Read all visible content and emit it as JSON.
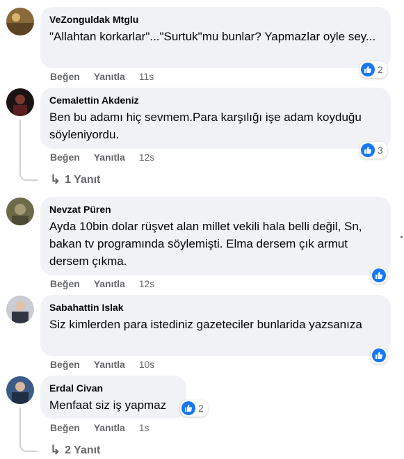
{
  "comments": [
    {
      "name": "VeZonguldak Mtglu",
      "text": "\"Allahtan korkarlar\"...\"Surtuk\"mu bunlar? Yapmazlar oyle sey...",
      "like": "Beğen",
      "reply": "Yanıtla",
      "time": "11s",
      "reactions": "2"
    },
    {
      "name": "Cemalettin Akdeniz",
      "text": "Ben bu adamı hiç sevmem.Para karşılığı işe adam koyduğu söyleniyordu.",
      "like": "Beğen",
      "reply": "Yanıtla",
      "time": "12s",
      "reactions": "3",
      "replies_link": "1 Yanıt"
    },
    {
      "name": "Nevzat Püren",
      "text": "Ayda 10bin dolar rüşvet alan millet vekili hala belli değil, Sn, bakan tv programında söylemişti. Elma dersem çık armut dersem çıkma.",
      "like": "Beğen",
      "reply": "Yanıtla",
      "time": "12s"
    },
    {
      "name": "Sabahattin Islak",
      "text": "Siz kimlerden para istediniz gazeteciler bunlarida yazsanıza",
      "like": "Beğen",
      "reply": "Yanıtla",
      "time": "10s"
    },
    {
      "name": "Erdal Civan",
      "text": "Menfaat siz iş yapmaz",
      "like": "Beğen",
      "reply": "Yanıtla",
      "time": "1s",
      "reactions": "2",
      "replies_link": "2 Yanıt"
    }
  ],
  "icons": {
    "like": "thumbs-up-icon",
    "reply_arrow": "reply-arrow-icon"
  },
  "colors": {
    "bubble": "#f0f2f5",
    "meta": "#65676b",
    "like_blue": "#1877f2"
  }
}
